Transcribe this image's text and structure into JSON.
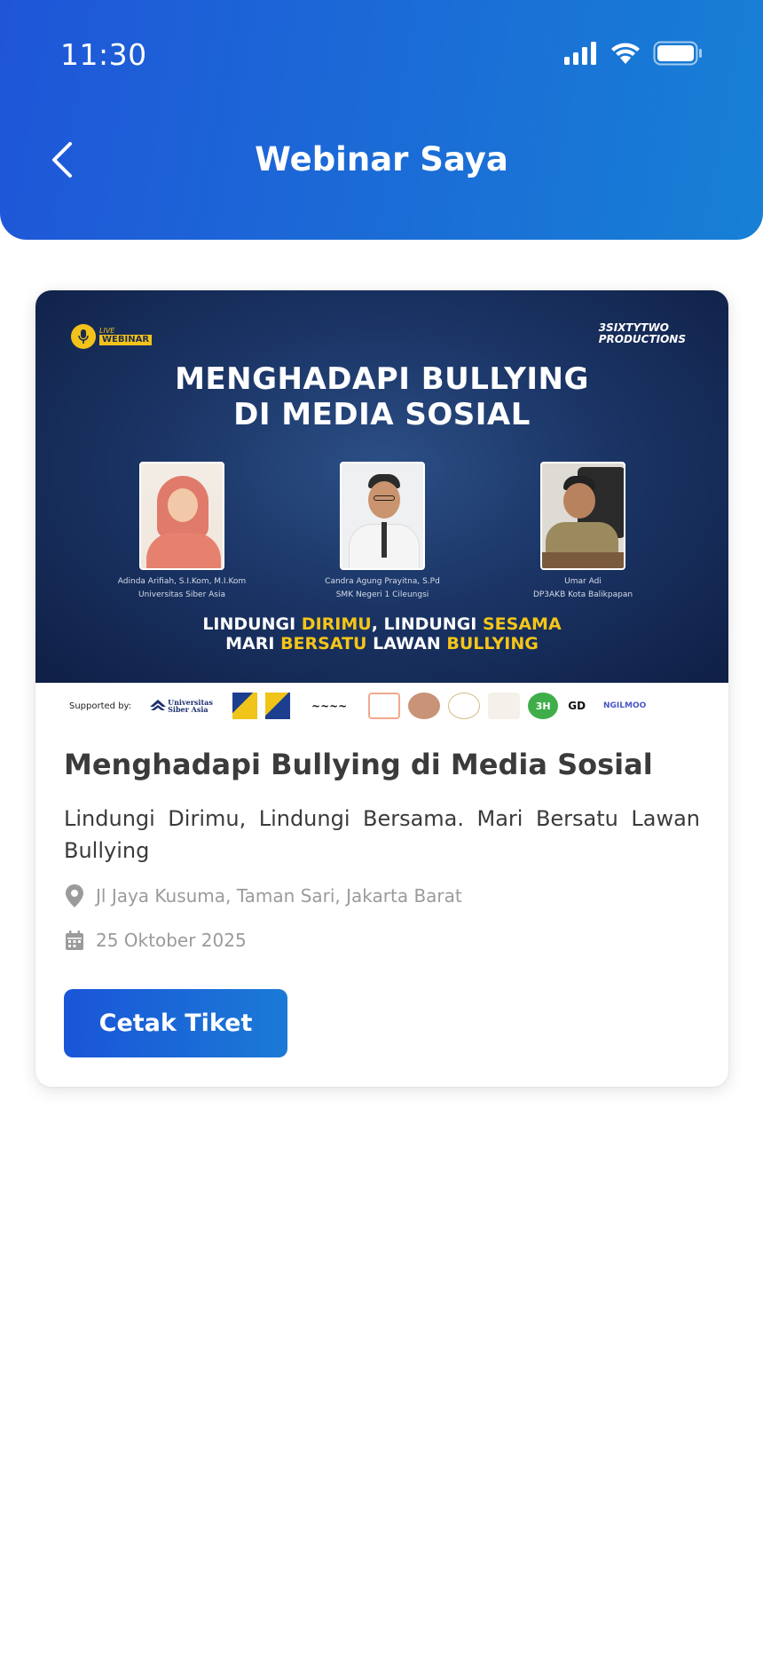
{
  "status_bar": {
    "time": "11:30"
  },
  "header": {
    "title": "Webinar Saya",
    "back_icon": "chevron-left-icon"
  },
  "colors": {
    "primary": "#1f56d8",
    "primary_end": "#1780d5",
    "highlight": "#f5c518",
    "muted": "#9b9b9b",
    "text": "#3b3b3b"
  },
  "banner": {
    "badge_small": "LIVE",
    "badge_big": "WEBINAR",
    "producer_line1": "3SIXTYTWO",
    "producer_line2": "PRODUCTIONS",
    "title_line1": "MENGHADAPI BULLYING",
    "title_line2": "DI MEDIA SOSIAL",
    "speakers": [
      {
        "name": "Adinda Arifiah, S.I.Kom, M.I.Kom",
        "org": "Universitas Siber Asia"
      },
      {
        "name": "Candra Agung Prayitna, S.Pd",
        "org": "SMK Negeri 1 Cileungsi"
      },
      {
        "name": "Umar Adi",
        "org": "DP3AKB Kota Balikpapan"
      }
    ],
    "tag_line1_a": "LINDUNGI ",
    "tag_line1_b": "DIRIMU",
    "tag_line1_c": ", LINDUNGI ",
    "tag_line1_d": "SESAMA",
    "tag_line2_a": "MARI ",
    "tag_line2_b": "BERSATU",
    "tag_line2_c": " LAWAN ",
    "tag_line2_d": "BULLYING",
    "supported_label": "Supported by:",
    "sponsors": [
      "Universitas Siber Asia",
      "NGILMOO"
    ]
  },
  "event": {
    "title": "Menghadapi Bullying di Media Sosial",
    "description": "Lindungi Dirimu, Lindungi Bersama. Mari Bersatu Lawan Bullying",
    "location": "Jl Jaya Kusuma, Taman Sari, Jakarta Barat",
    "date": "25 Oktober 2025",
    "location_icon": "map-pin-icon",
    "date_icon": "calendar-icon"
  },
  "actions": {
    "print_ticket": "Cetak Tiket"
  }
}
